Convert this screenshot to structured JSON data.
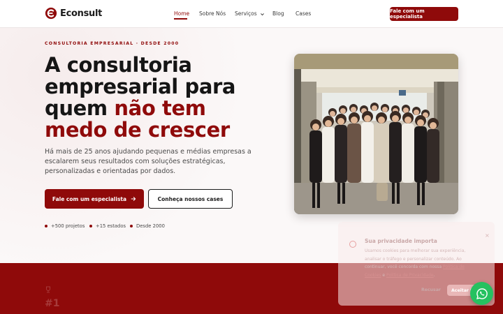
{
  "brand": {
    "name": "Econsult",
    "color": "#8f0a0a"
  },
  "nav": {
    "items": [
      {
        "label": "Home",
        "active": true
      },
      {
        "label": "Sobre Nós"
      },
      {
        "label": "Serviços",
        "icon": "chevron-down-icon"
      },
      {
        "label": "Blog"
      },
      {
        "label": "Cases"
      }
    ],
    "cta": "Fale com um especialista"
  },
  "hero": {
    "eyebrow": "CONSULTORIA EMPRESARIAL · DESDE 2000",
    "headline_1": "A consultoria",
    "headline_2": "empresarial para",
    "headline_3": "quem",
    "headline_accent_1": "não tem",
    "headline_accent_2": "medo de crescer",
    "subtitle": "Há mais de 25 anos ajudando pequenas e médias empresas a escalarem seus resultados com soluções estratégicas, personalizadas e orientadas por dados.",
    "primary_button": "Fale com um especialista",
    "secondary_button": "Conheça nossos cases",
    "stats": [
      "+500 projetos",
      "+15 estados",
      "Desde 2000"
    ]
  },
  "photo": {
    "description_icon": "team-photo"
  },
  "red_section": {
    "number": "#1",
    "icon": "trophy-icon"
  },
  "cookie": {
    "title": "Sua privacidade importa",
    "text_1": "Usamos cookies para melhorar sua experiência, analisar o tráfego e personalizar conteúdo. Ao continuar, você concorda com nossa",
    "link_1": "Política de Cookies",
    "text_2": "e",
    "link_2": "Política de Privacidade",
    "text_3": ".",
    "reject": "Recusar",
    "accept": "Aceitar tu"
  }
}
